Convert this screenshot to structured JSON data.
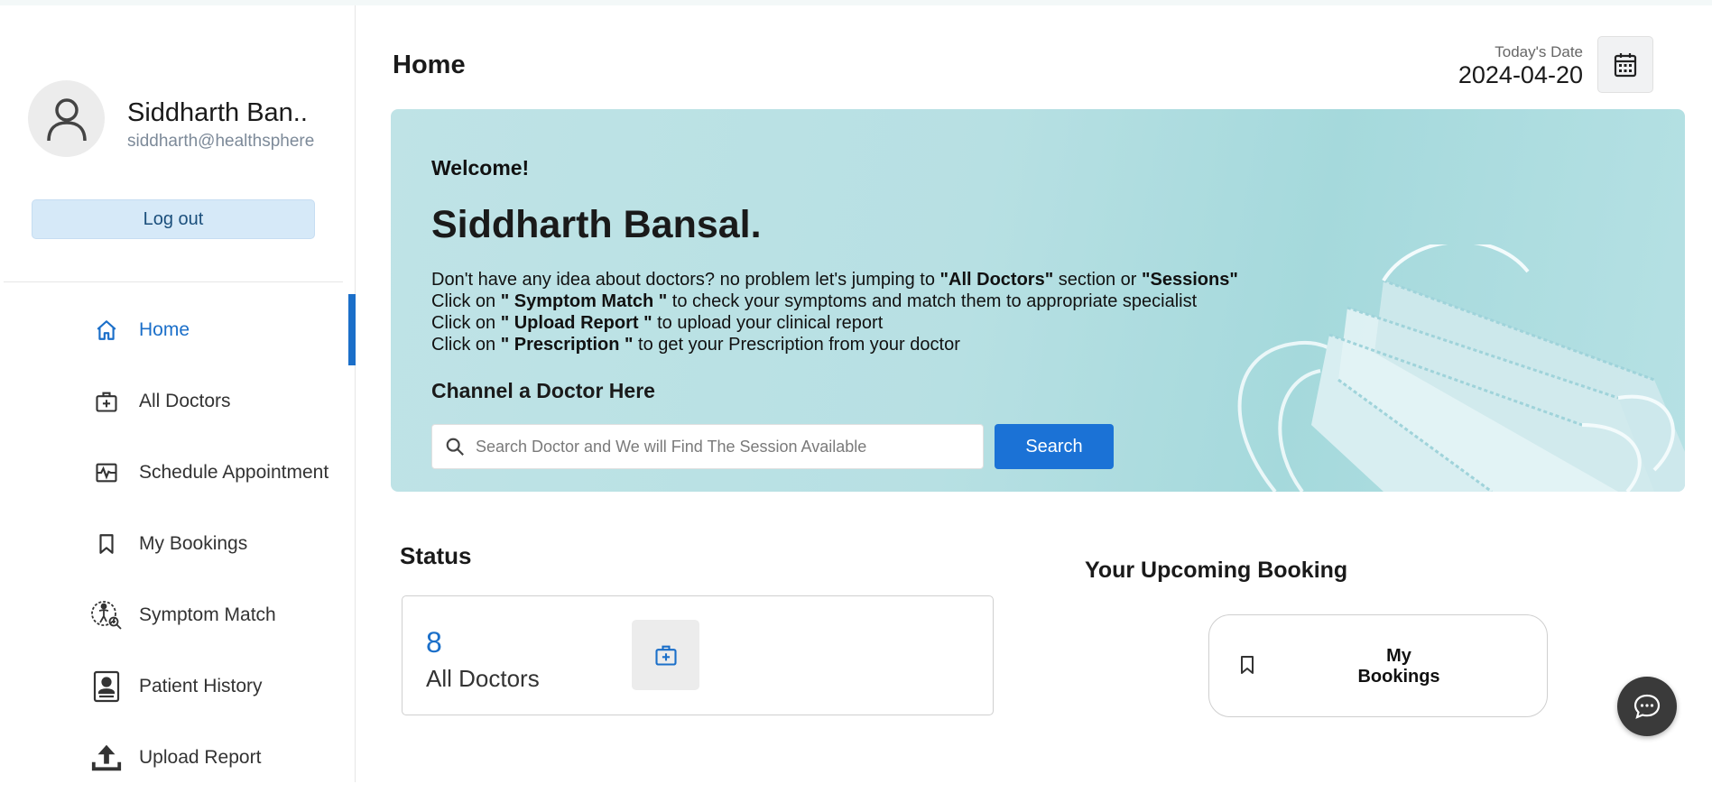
{
  "profile": {
    "name": "Siddharth Ban..",
    "email": "siddharth@healthsphere"
  },
  "sidebar": {
    "logout_label": "Log out",
    "items": [
      {
        "label": "Home",
        "icon": "home-icon",
        "active": true
      },
      {
        "label": "All Doctors",
        "icon": "medical-bag-icon"
      },
      {
        "label": "Schedule Appointment",
        "icon": "pulse-schedule-icon"
      },
      {
        "label": "My Bookings",
        "icon": "bookmark-icon"
      },
      {
        "label": "Symptom Match",
        "icon": "person-search-icon"
      },
      {
        "label": "Patient History",
        "icon": "patient-card-icon"
      },
      {
        "label": "Upload Report",
        "icon": "upload-icon"
      }
    ]
  },
  "header": {
    "title": "Home",
    "date_label": "Today's Date",
    "date_value": "2024-04-20"
  },
  "banner": {
    "welcome": "Welcome!",
    "name": "Siddharth Bansal.",
    "line1_pre": "Don't have any idea about doctors? no problem let's jumping to ",
    "line1_b1": "\"All Doctors\"",
    "line1_mid": " section or ",
    "line1_b2": "\"Sessions\"",
    "line2_pre": "Click on ",
    "line2_b": "\" Symptom Match \"",
    "line2_post": " to check your symptoms and match them to appropriate specialist",
    "line3_pre": "Click on ",
    "line3_b": "\" Upload Report \"",
    "line3_post": " to upload your clinical report",
    "line4_pre": "Click on ",
    "line4_b": "\" Prescription \"",
    "line4_post": " to get your Prescription from your doctor",
    "channel_title": "Channel a Doctor Here",
    "search_placeholder": "Search Doctor and We will Find The Session Available",
    "search_button": "Search"
  },
  "status": {
    "title": "Status",
    "count": "8",
    "label": "All Doctors"
  },
  "upcoming": {
    "title": "Your Upcoming Booking",
    "card_line1": "My",
    "card_line2": "Bookings"
  },
  "colors": {
    "accent": "#1b6fc9",
    "banner_bg": "#b7e0e3",
    "logout_bg": "#d6e9f8"
  }
}
